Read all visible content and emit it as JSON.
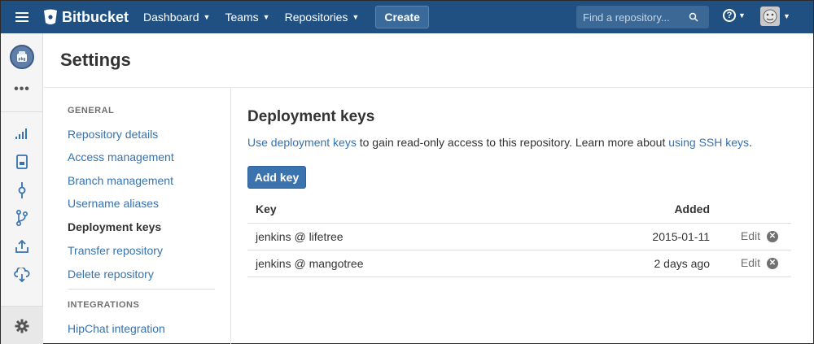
{
  "topbar": {
    "brand": "Bitbucket",
    "nav": [
      {
        "label": "Dashboard"
      },
      {
        "label": "Teams"
      },
      {
        "label": "Repositories"
      }
    ],
    "create_label": "Create",
    "search_placeholder": "Find a repository...",
    "help_icon": "?"
  },
  "rail": {
    "repo_avatar_text": "pkg",
    "more_label": "•••"
  },
  "page": {
    "title": "Settings"
  },
  "settings_nav": {
    "general_heading": "GENERAL",
    "general_items": [
      {
        "label": "Repository details"
      },
      {
        "label": "Access management"
      },
      {
        "label": "Branch management"
      },
      {
        "label": "Username aliases"
      },
      {
        "label": "Deployment keys"
      },
      {
        "label": "Transfer repository"
      },
      {
        "label": "Delete repository"
      }
    ],
    "integrations_heading": "INTEGRATIONS",
    "integration_items": [
      {
        "label": "HipChat integration"
      }
    ]
  },
  "content": {
    "title": "Deployment keys",
    "description_link1": "Use deployment keys",
    "description_middle": " to gain read-only access to this repository. Learn more about ",
    "description_link2": "using SSH keys",
    "description_end": ".",
    "add_key_label": "Add key",
    "table": {
      "headers": {
        "key": "Key",
        "added": "Added"
      },
      "rows": [
        {
          "key": "jenkins @ lifetree",
          "added": "2015-01-11",
          "edit": "Edit"
        },
        {
          "key": "jenkins @ mangotree",
          "added": "2 days ago",
          "edit": "Edit"
        }
      ]
    }
  },
  "colors": {
    "header_bg": "#205081",
    "link": "#3572b0",
    "primary_button": "#3b73af"
  }
}
